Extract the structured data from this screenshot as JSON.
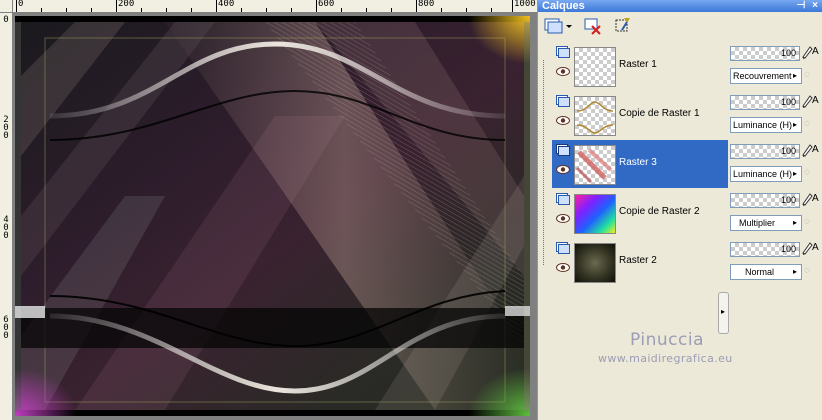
{
  "rulers": {
    "top": [
      "0",
      "200",
      "400",
      "600",
      "800",
      "1000"
    ],
    "left": [
      "0",
      "2\n0\n0",
      "4\n0\n0",
      "6\n0\n0"
    ]
  },
  "palette": {
    "title": "Calques",
    "title_buttons": [
      "pin-icon",
      "close-icon"
    ]
  },
  "layers": [
    {
      "name": "Raster 1",
      "opacity": "100",
      "blend": "Recouvrement",
      "selected": false,
      "thumb": "transparent"
    },
    {
      "name": "Copie de Raster 1",
      "opacity": "100",
      "blend": "Luminance (H)",
      "selected": false,
      "thumb": "waves"
    },
    {
      "name": "Raster 3",
      "opacity": "100",
      "blend": "Luminance (H)",
      "selected": true,
      "thumb": "red-strokes"
    },
    {
      "name": "Copie de Raster 2",
      "opacity": "100",
      "blend": "Multiplier",
      "selected": false,
      "thumb": "rainbow"
    },
    {
      "name": "Raster 2",
      "opacity": "100",
      "blend": "Normal",
      "selected": false,
      "thumb": "dark"
    }
  ],
  "watermark": {
    "name": "Pinuccia",
    "url": "www.maidiregrafica.eu"
  },
  "colors": {
    "title_bar": "#3c78d8",
    "selection": "#316ac5",
    "panel_bg": "#ece9d8"
  }
}
